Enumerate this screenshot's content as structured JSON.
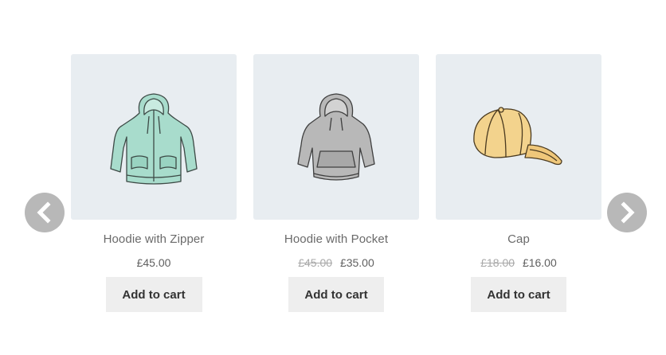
{
  "products": [
    {
      "title": "Hoodie with Zipper",
      "price": "£45.00",
      "old_price": "",
      "button": "Add to cart",
      "image_icon": "hoodie-with-zipper-icon",
      "color": "#a8dccc"
    },
    {
      "title": "Hoodie with Pocket",
      "price": "£35.00",
      "old_price": "£45.00",
      "button": "Add to cart",
      "image_icon": "hoodie-with-pocket-icon",
      "color": "#b8b8b8"
    },
    {
      "title": "Cap",
      "price": "£16.00",
      "old_price": "£18.00",
      "button": "Add to cart",
      "image_icon": "cap-icon",
      "color": "#f3d38d"
    }
  ],
  "nav": {
    "prev_icon": "chevron-left-icon",
    "next_icon": "chevron-right-icon",
    "arrow_color": "#b8b8b8"
  },
  "colors": {
    "image_background": "#e8edf1",
    "button_background": "#eeeeee"
  }
}
